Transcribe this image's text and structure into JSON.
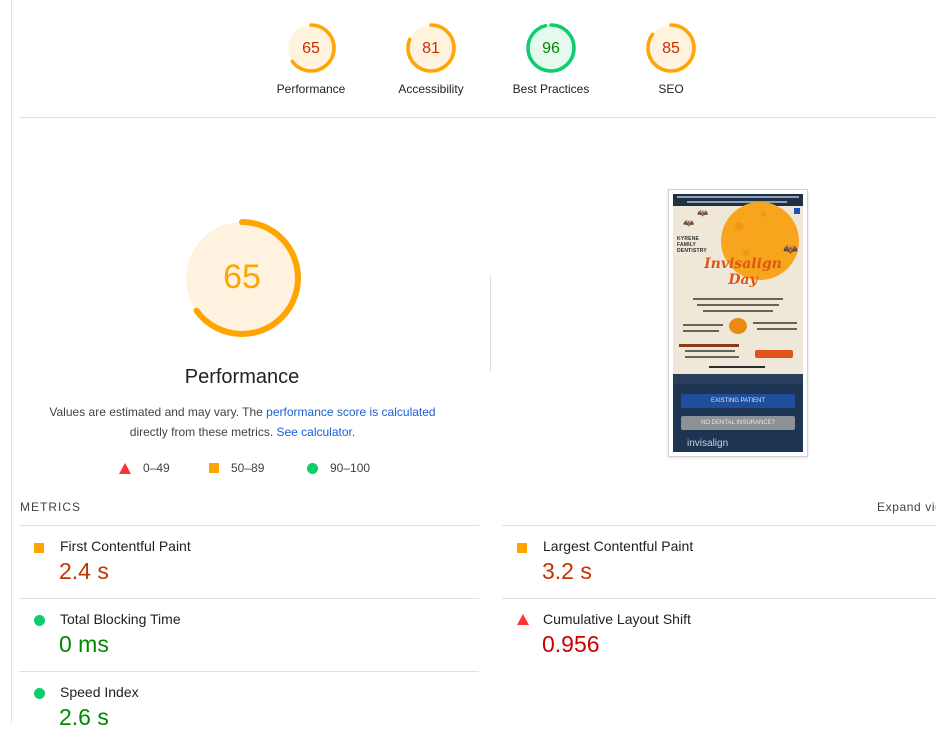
{
  "colors": {
    "fail": "#ff3333",
    "average": "#ffa400",
    "pass": "#0cce6b",
    "average_text": "#c33300",
    "pass_text": "#008800",
    "fail_text": "#cc0000",
    "link": "#1a5fd6"
  },
  "categories": [
    {
      "label": "Performance",
      "score": "65",
      "score_value": 65,
      "rating": "average"
    },
    {
      "label": "Accessibility",
      "score": "81",
      "score_value": 81,
      "rating": "average"
    },
    {
      "label": "Best Practices",
      "score": "96",
      "score_value": 96,
      "rating": "pass"
    },
    {
      "label": "SEO",
      "score": "85",
      "score_value": 85,
      "rating": "average"
    }
  ],
  "performance": {
    "score": "65",
    "score_value": 65,
    "title": "Performance",
    "desc_prefix": "Values are estimated and may vary. The ",
    "desc_link": "performance score is calculated",
    "desc_middle": " directly from these metrics. ",
    "desc_calc_link": "See calculator",
    "desc_suffix": "."
  },
  "legend": [
    {
      "icon": "fail-triangle-icon",
      "range": "0–49"
    },
    {
      "icon": "average-square-icon",
      "range": "50–89"
    },
    {
      "icon": "pass-circle-icon",
      "range": "90–100"
    }
  ],
  "metrics": {
    "title": "METRICS",
    "expand_label": "Expand view",
    "items": [
      {
        "name": "First Contentful Paint",
        "value": "2.4 s",
        "rating": "average"
      },
      {
        "name": "Largest Contentful Paint",
        "value": "3.2 s",
        "rating": "average"
      },
      {
        "name": "Total Blocking Time",
        "value": "0 ms",
        "rating": "pass"
      },
      {
        "name": "Cumulative Layout Shift",
        "value": "0.956",
        "rating": "fail"
      },
      {
        "name": "Speed Index",
        "value": "2.6 s",
        "rating": "pass"
      }
    ]
  },
  "screenshot": {
    "brand": "KYRENE FAMILY DENTISTRY",
    "headline": "Invisalign Day",
    "button_existing": "EXISTING PATIENT",
    "button_insurance": "NO DENTAL INSURANCE?",
    "footer_logo": "invisalign"
  }
}
